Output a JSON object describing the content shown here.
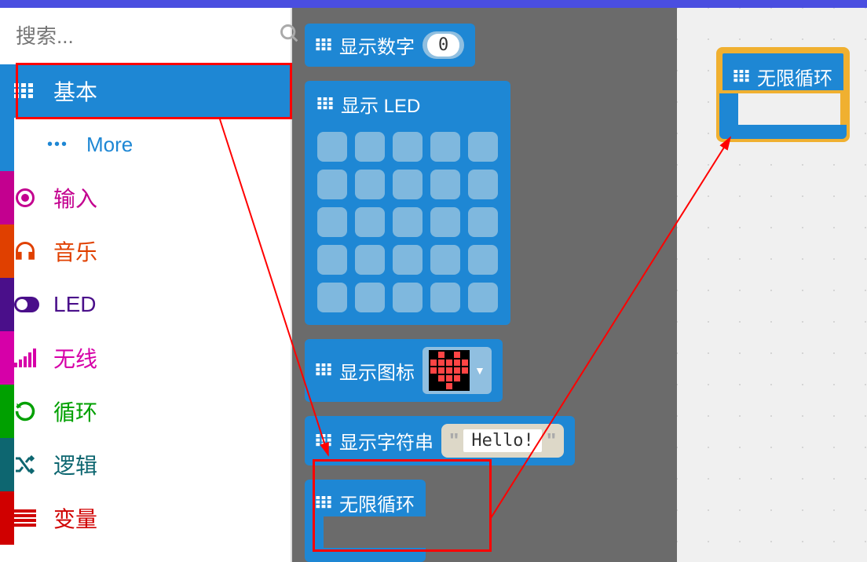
{
  "search": {
    "placeholder": "搜索..."
  },
  "categories": [
    {
      "id": "basic",
      "label": "基本",
      "color": "#1e87d4",
      "active": true
    },
    {
      "id": "more",
      "label": "More",
      "color": "#1e87d4",
      "sub": true
    },
    {
      "id": "input",
      "label": "输入",
      "color": "#c3008f"
    },
    {
      "id": "music",
      "label": "音乐",
      "color": "#e04000"
    },
    {
      "id": "led",
      "label": "LED",
      "color": "#4a0f8a"
    },
    {
      "id": "radio",
      "label": "无线",
      "color": "#d600a8"
    },
    {
      "id": "loops",
      "label": "循环",
      "color": "#00a000"
    },
    {
      "id": "logic",
      "label": "逻辑",
      "color": "#0d6670"
    },
    {
      "id": "variables",
      "label": "变量",
      "color": "#d00000"
    }
  ],
  "blocks": {
    "show_number": {
      "label": "显示数字",
      "value": "0"
    },
    "show_leds": {
      "label": "显示 LED"
    },
    "show_icon": {
      "label": "显示图标"
    },
    "show_string": {
      "label": "显示字符串",
      "value": "Hello!"
    },
    "forever": {
      "label": "无限循环"
    }
  },
  "canvas": {
    "forever": {
      "label": "无限循环"
    }
  }
}
